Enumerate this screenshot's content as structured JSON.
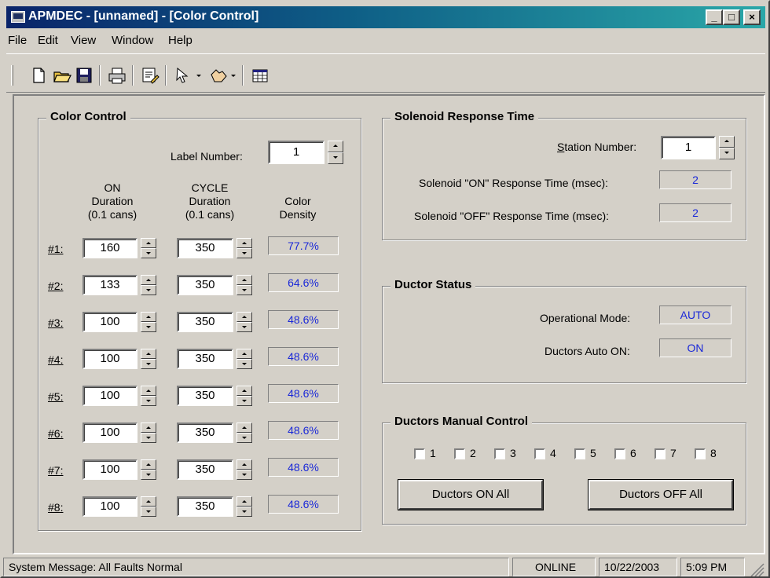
{
  "window": {
    "title": "APMDEC - [unnamed] - [Color Control]",
    "minimize_label": "_",
    "maximize_label": "□",
    "close_label": "×"
  },
  "menu": {
    "items": [
      "File",
      "Edit",
      "View",
      "Window",
      "Help"
    ]
  },
  "toolbar": {
    "buttons": [
      "new-file-icon",
      "open-folder-icon",
      "save-icon",
      "print-icon",
      "edit-document-icon",
      "pointer-dropdown-icon",
      "hand-dropdown-icon",
      "table-icon"
    ]
  },
  "color_control": {
    "title": "Color Control",
    "label_number_label": "Label Number:",
    "label_number_value": "1",
    "col_on": [
      "ON",
      "Duration",
      "(0.1 cans)"
    ],
    "col_cycle": [
      "CYCLE",
      "Duration",
      "(0.1 cans)"
    ],
    "col_density": [
      "Color",
      "Density"
    ],
    "rows": [
      {
        "label": "#1:",
        "on": "160",
        "cycle": "350",
        "density": "77.7%"
      },
      {
        "label": "#2:",
        "on": "133",
        "cycle": "350",
        "density": "64.6%"
      },
      {
        "label": "#3:",
        "on": "100",
        "cycle": "350",
        "density": "48.6%"
      },
      {
        "label": "#4:",
        "on": "100",
        "cycle": "350",
        "density": "48.6%"
      },
      {
        "label": "#5:",
        "on": "100",
        "cycle": "350",
        "density": "48.6%"
      },
      {
        "label": "#6:",
        "on": "100",
        "cycle": "350",
        "density": "48.6%"
      },
      {
        "label": "#7:",
        "on": "100",
        "cycle": "350",
        "density": "48.6%"
      },
      {
        "label": "#8:",
        "on": "100",
        "cycle": "350",
        "density": "48.6%"
      }
    ]
  },
  "solenoid": {
    "title": "Solenoid Response Time",
    "station_label": "Station Number:",
    "station_value": "1",
    "on_label": "Solenoid \"ON\" Response Time (msec):",
    "on_value": "2",
    "off_label": "Solenoid \"OFF\" Response Time (msec):",
    "off_value": "2"
  },
  "ductor_status": {
    "title": "Ductor Status",
    "mode_label": "Operational Mode:",
    "mode_value": "AUTO",
    "auto_label": "Ductors Auto ON:",
    "auto_value": "ON"
  },
  "manual": {
    "title": "Ductors Manual Control",
    "checkboxes": [
      "1",
      "2",
      "3",
      "4",
      "5",
      "6",
      "7",
      "8"
    ],
    "on_all": "Ductors ON All",
    "off_all": "Ductors OFF All"
  },
  "status": {
    "message": "System Message:  All Faults Normal",
    "online": "ONLINE",
    "date": "10/22/2003",
    "time": "5:09 PM"
  }
}
